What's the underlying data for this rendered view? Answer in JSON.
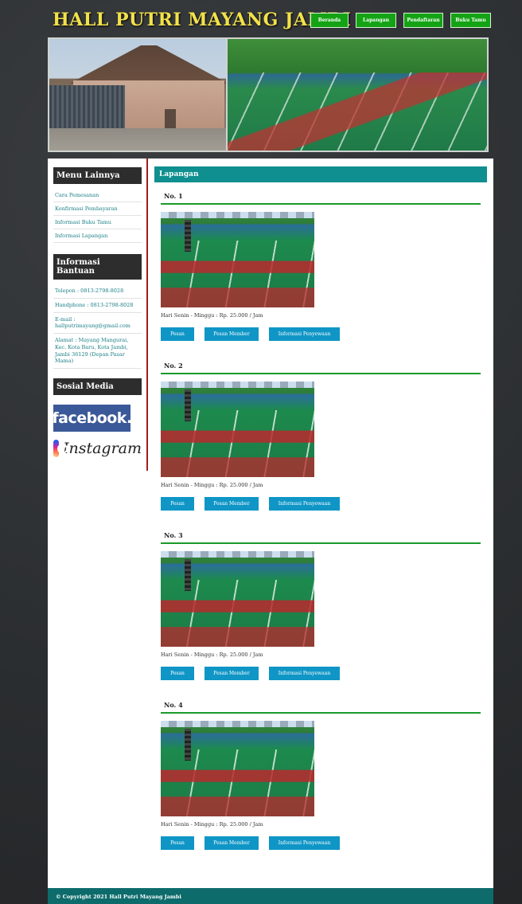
{
  "header": {
    "site_title": "HALL PUTRI MAYANG JAMBI",
    "nav": [
      "Beranda",
      "Lapangan",
      "Pendaftaran",
      "Buku Tamu"
    ]
  },
  "sidebar": {
    "menu_title": "Menu Lainnya",
    "menu_items": [
      "Cara Pemesanan",
      "Konfirmasi Pembayaran",
      "Informasi Buku Tamu",
      "Informasi Lapangan"
    ],
    "help_title": "Informasi Bantuan",
    "help_items": [
      "Telepon : 0813-2798-8028",
      "Handphone : 0813-2798-8028",
      "E-mail : hallputrimayang@gmail.com",
      "Alamat : Mayang Mangurai, Kec. Kota Baru, Kota Jambi, Jambi 36129 (Depan Pasar Mama)"
    ],
    "social_title": "Sosial Media",
    "facebook_label": "facebook.",
    "instagram_label": "Instagram"
  },
  "main": {
    "title": "Lapangan",
    "courts": [
      {
        "name": "No. 1",
        "desc": "Hari Senin - Minggu : Rp. 25.000 / Jam"
      },
      {
        "name": "No. 2",
        "desc": "Hari Senin - Minggu : Rp. 25.000 / Jam"
      },
      {
        "name": "No. 3",
        "desc": "Hari Senin - Minggu : Rp. 25.000 / Jam"
      },
      {
        "name": "No. 4",
        "desc": "Hari Senin - Minggu : Rp. 25.000 / Jam"
      }
    ],
    "buttons": {
      "pesan": "Pesan",
      "pesan_member": "Pesan Member",
      "info": "Informasi Penyewaan"
    }
  },
  "footer": {
    "copyright": "© Copyright 2021 Hall Putri Mayang Jambi"
  },
  "colors": {
    "title": "#f2e24a",
    "nav": "#14a314",
    "accent": "#0f8f8f",
    "button": "#0f96c6",
    "divider": "#a11d1d"
  }
}
